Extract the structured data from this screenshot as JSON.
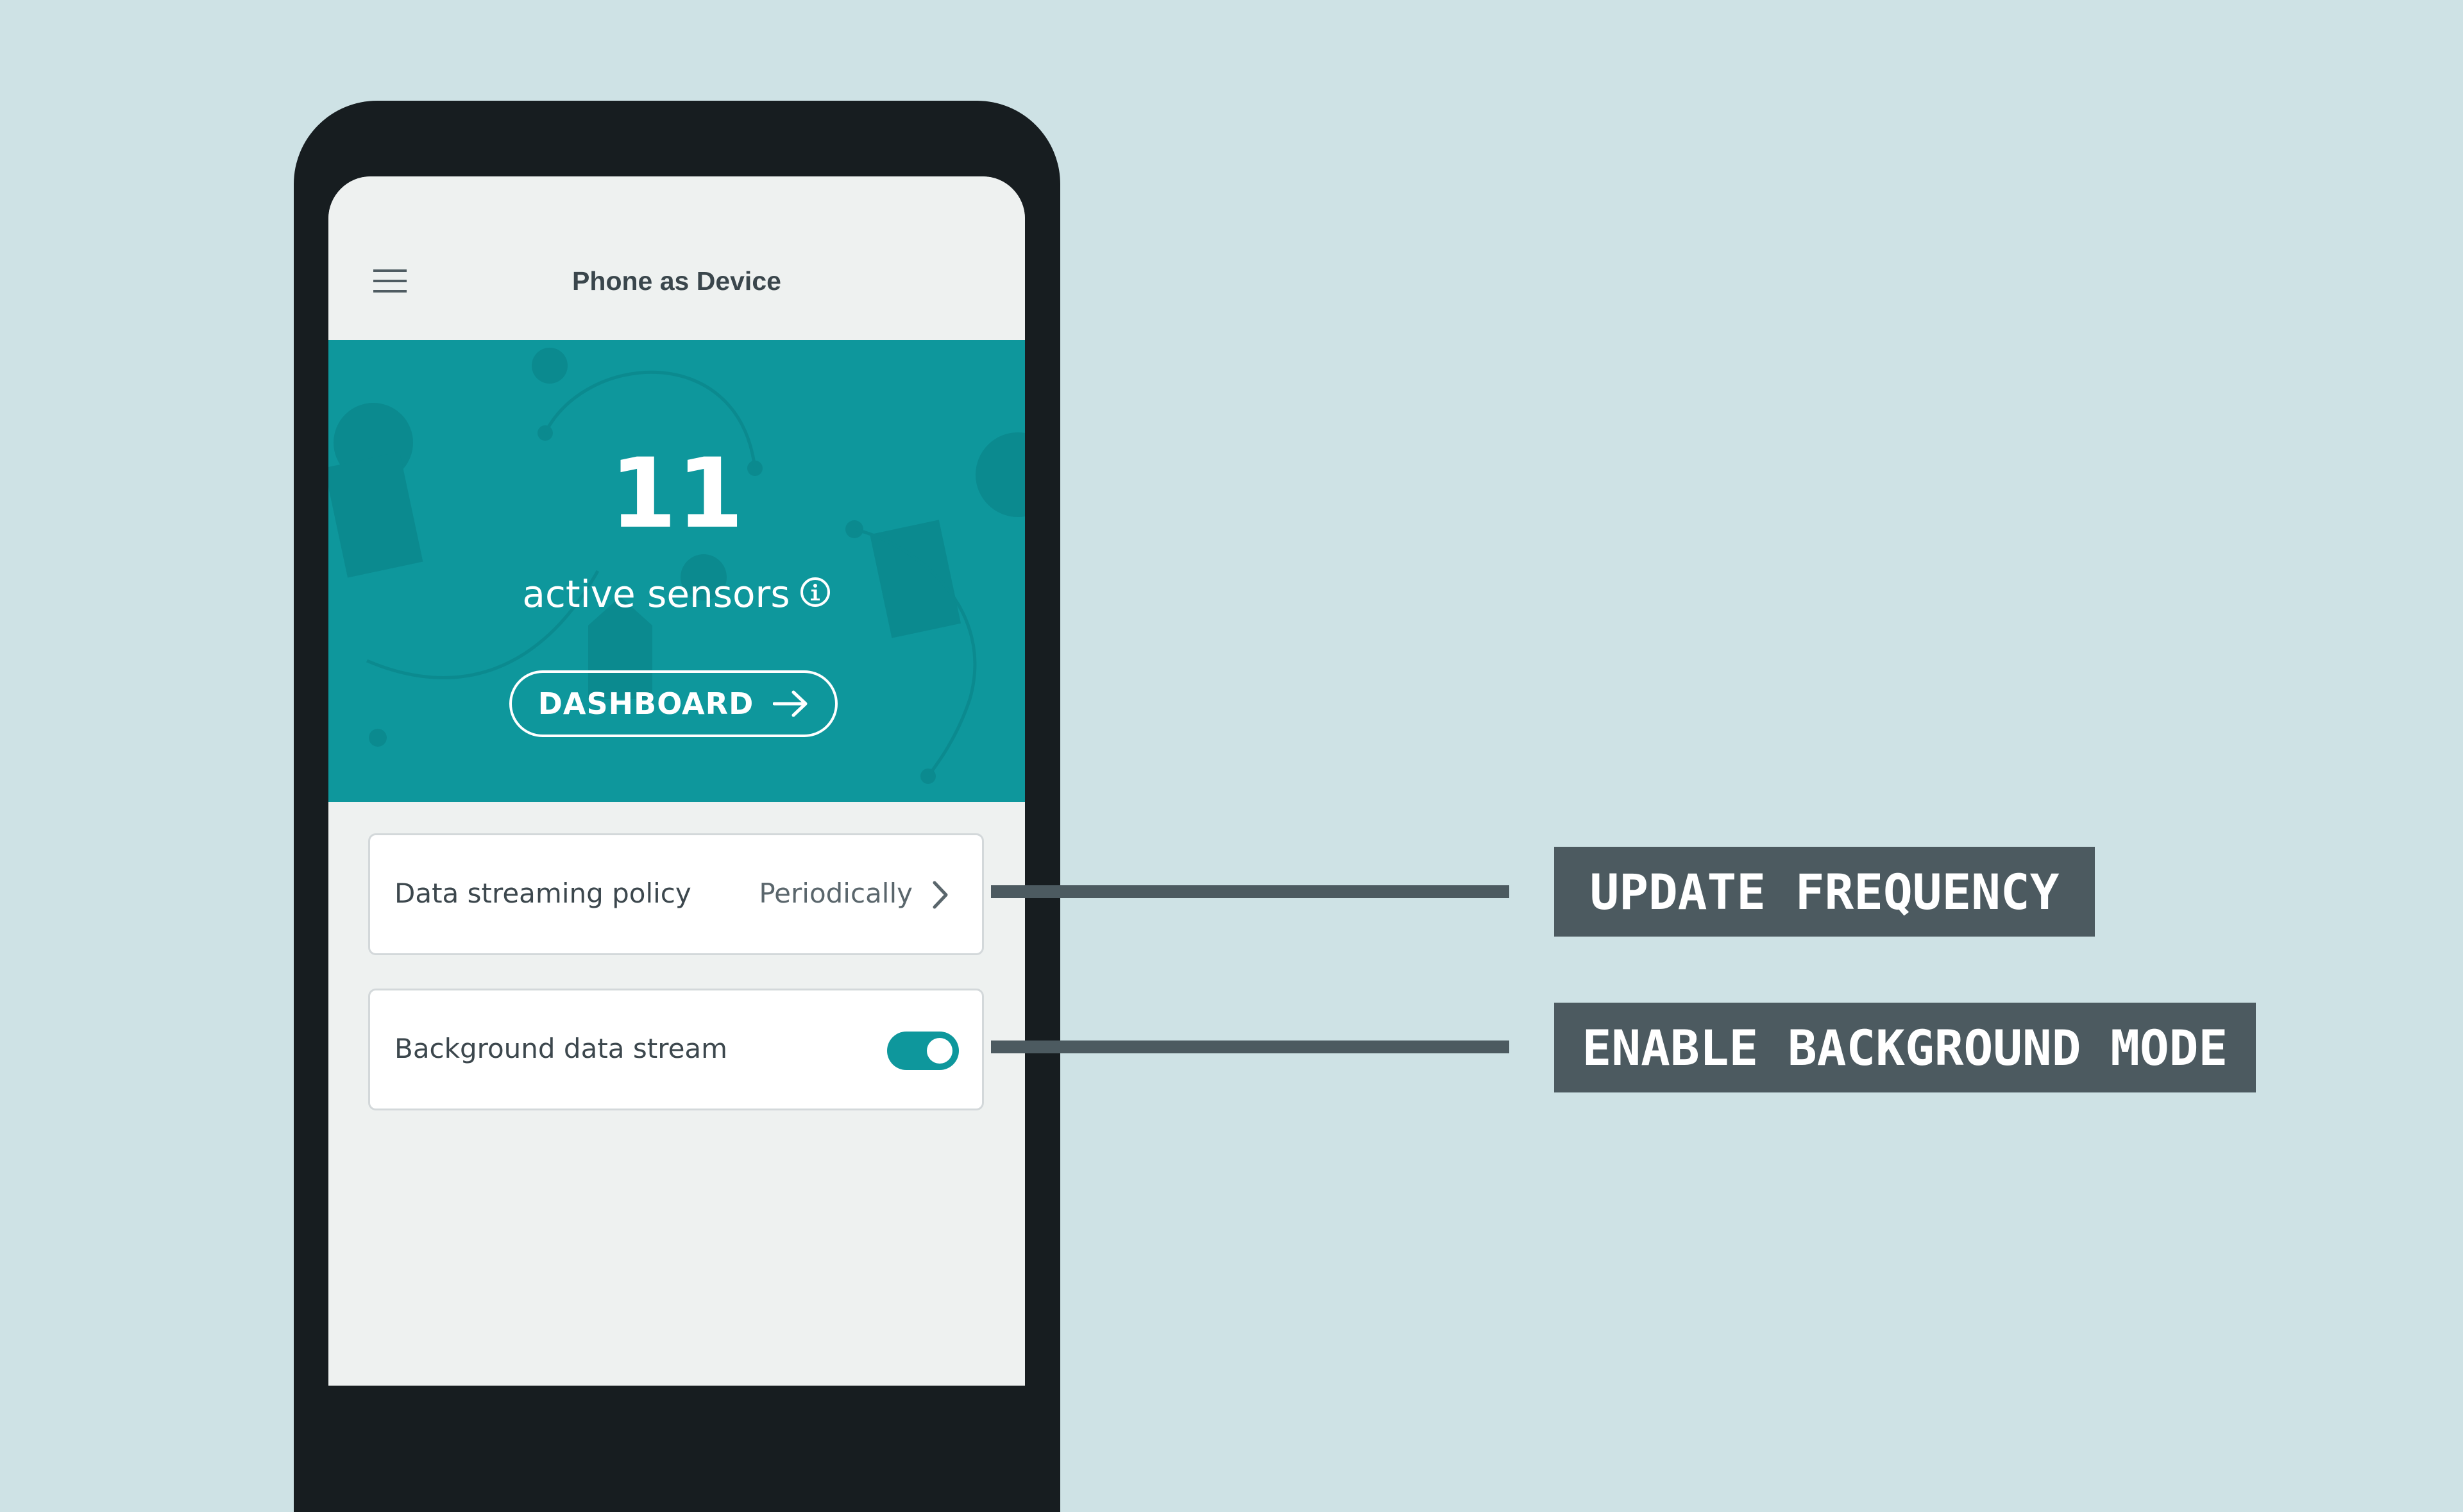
{
  "app": {
    "title": "Phone as Device"
  },
  "hero": {
    "count": "11",
    "label": "active sensors",
    "button_label": "DASHBOARD"
  },
  "settings": [
    {
      "label": "Data streaming policy",
      "value": "Periodically"
    },
    {
      "label": "Background data stream",
      "toggle_on": true
    }
  ],
  "callouts": [
    {
      "text": "UPDATE FREQUENCY"
    },
    {
      "text": "ENABLE BACKGROUND MODE"
    }
  ],
  "colors": {
    "background": "#cee2e5",
    "phone_frame": "#171d20",
    "screen": "#eef1f0",
    "accent": "#0e979c",
    "callout": "#4c5a60"
  },
  "icons": [
    "menu-icon",
    "info-icon",
    "arrow-right-icon",
    "chevron-right-icon"
  ]
}
